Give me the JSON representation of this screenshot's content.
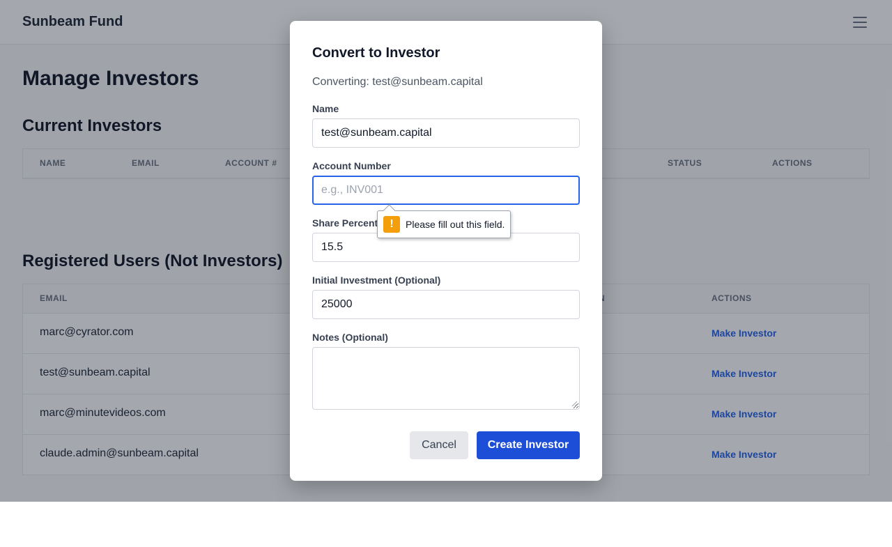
{
  "app": {
    "brand": "Sunbeam Fund",
    "menu_icon": "hamburger-menu-icon"
  },
  "page": {
    "title": "Manage Investors",
    "current_investors": {
      "title": "Current Investors",
      "columns": [
        "NAME",
        "EMAIL",
        "ACCOUNT #",
        "STATUS",
        "ACTIONS"
      ]
    },
    "registered_users": {
      "title": "Registered Users (Not Investors)",
      "columns": [
        "EMAIL",
        "N",
        "ACTIONS"
      ],
      "rows": [
        {
          "email": "marc@cyrator.com",
          "action": "Make Investor"
        },
        {
          "email": "test@sunbeam.capital",
          "action": "Make Investor"
        },
        {
          "email": "marc@minutevideos.com",
          "action": "Make Investor"
        },
        {
          "email": "claude.admin@sunbeam.capital",
          "action": "Make Investor"
        }
      ]
    }
  },
  "modal": {
    "title": "Convert to Investor",
    "subtitle": "Converting: test@sunbeam.capital",
    "fields": {
      "name": {
        "label": "Name",
        "value": "test@sunbeam.capital"
      },
      "account_number": {
        "label": "Account Number",
        "value": "",
        "placeholder": "e.g., INV001"
      },
      "share_percentage": {
        "label": "Share Percent",
        "value": "15.5"
      },
      "initial_investment": {
        "label": "Initial Investment (Optional)",
        "value": "25000"
      },
      "notes": {
        "label": "Notes (Optional)",
        "value": ""
      }
    },
    "cancel_label": "Cancel",
    "create_label": "Create Investor"
  },
  "validation_tooltip": {
    "icon": "warning-icon",
    "icon_glyph": "!",
    "message": "Please fill out this field."
  },
  "colors": {
    "primary": "#1d4ed8",
    "link": "#2563eb",
    "warning": "#f59e0b",
    "focus_ring": "#2563eb"
  }
}
